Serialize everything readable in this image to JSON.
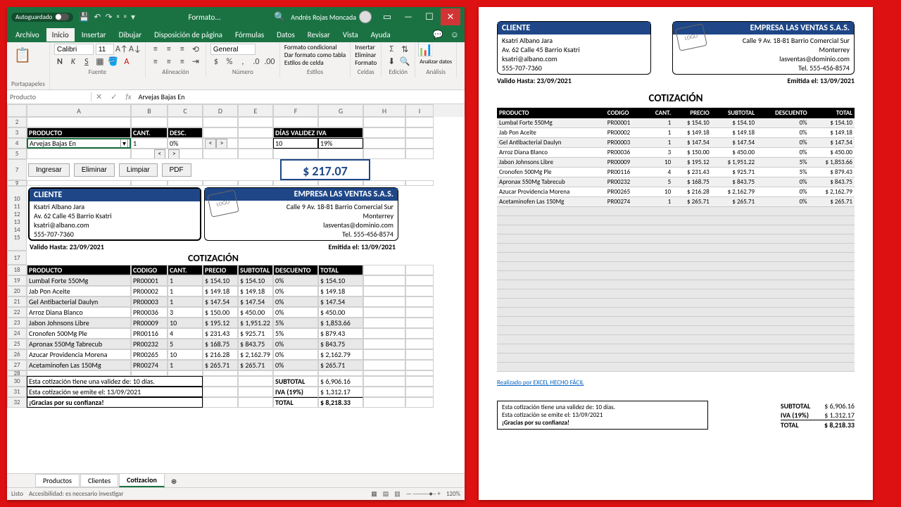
{
  "titlebar": {
    "autosave": "Autoguardado",
    "filename": "Formato...",
    "user": "Andrés Rojas Moncada"
  },
  "menutabs": [
    "Archivo",
    "Inicio",
    "Insertar",
    "Dibujar",
    "Disposición de página",
    "Fórmulas",
    "Datos",
    "Revisar",
    "Vista",
    "Ayuda"
  ],
  "font": {
    "name": "Calibri",
    "size": "11"
  },
  "ribbon": {
    "portapapeles": "Portapapeles",
    "fuente": "Fuente",
    "alineacion": "Alineación",
    "numero": "Número",
    "general": "General",
    "estilos": "Estilos",
    "fcond": "Formato condicional",
    "ftabla": "Dar formato como tabla",
    "fcelda": "Estilos de celda",
    "celdas": "Celdas",
    "insertar": "Insertar",
    "eliminar": "Eliminar",
    "formato": "Formato",
    "edicion": "Edición",
    "analisis": "Análisis",
    "analizar": "Analizar datos"
  },
  "namebox": {
    "name": "Producto",
    "formula": "Arvejas Bajas En"
  },
  "cols": [
    "A",
    "B",
    "C",
    "D",
    "E",
    "F",
    "G",
    "H",
    "I"
  ],
  "hdr": {
    "producto": "PRODUCTO",
    "cant": "CANT.",
    "desc": "DESC.",
    "validez": "DÍAS VALIDEZ",
    "iva": "IVA",
    "codigo": "CODIGO",
    "precio": "PRECIO",
    "subtotal": "SUBTOTAL",
    "descuento": "DESCUENTO",
    "total": "TOTAL"
  },
  "input": {
    "producto": "Arvejas Bajas En",
    "cant": "1",
    "desc": "0%",
    "dias": "10",
    "iva": "19%"
  },
  "buttons": {
    "ingresar": "Ingresar",
    "eliminar": "Eliminar",
    "limpiar": "Limpiar",
    "pdf": "PDF"
  },
  "bigtotal": "$ 217.07",
  "cliente": {
    "title": "CLIENTE",
    "name": "Ksatri Albano Jara",
    "addr": "Av. 62 Calle 45 Barrio Ksatri",
    "email": "ksatri@albano.com",
    "tel": "555-707-7360",
    "valido": "Valido Hasta: 23/09/2021"
  },
  "empresa": {
    "title": "EMPRESA LAS VENTAS S.A.S.",
    "addr": "Calle 9 Av. 18-81 Barrio Comercial Sur",
    "city": "Monterrey",
    "email": "lasventas@dominio.com",
    "tel": "Tel. 555-456-8574",
    "emitida": "Emitida el: 13/09/2021",
    "logo": "LOGO"
  },
  "cotizacion": "COTIZACIÓN",
  "items": [
    {
      "p": "Lumbal Forte 550Mg",
      "c": "PR00001",
      "q": "1",
      "pr": "$ 154.10",
      "st": "$ 154.10",
      "d": "0%",
      "t": "$ 154.10"
    },
    {
      "p": "Jab Pon Aceite",
      "c": "PR00002",
      "q": "1",
      "pr": "$ 149.18",
      "st": "$ 149.18",
      "d": "0%",
      "t": "$ 149.18"
    },
    {
      "p": "Gel Antibacterial Daulyn",
      "c": "PR00003",
      "q": "1",
      "pr": "$ 147.54",
      "st": "$ 147.54",
      "d": "0%",
      "t": "$ 147.54"
    },
    {
      "p": "Arroz Diana Blanco",
      "c": "PR00036",
      "q": "3",
      "pr": "$ 150.00",
      "st": "$ 450.00",
      "d": "0%",
      "t": "$ 450.00"
    },
    {
      "p": "Jabon Johnsons Libre",
      "c": "PR00009",
      "q": "10",
      "pr": "$ 195.12",
      "st": "$ 1,951.22",
      "d": "5%",
      "t": "$ 1,853.66"
    },
    {
      "p": "Cronofen 500Mg Ple",
      "c": "PR00116",
      "q": "4",
      "pr": "$ 231.43",
      "st": "$ 925.71",
      "d": "5%",
      "t": "$ 879.43"
    },
    {
      "p": "Apronax 550Mg Tabrecub",
      "c": "PR00232",
      "q": "5",
      "pr": "$ 168.75",
      "st": "$ 843.75",
      "d": "0%",
      "t": "$ 843.75"
    },
    {
      "p": "Azucar Providencia Morena",
      "c": "PR00265",
      "q": "10",
      "pr": "$ 216.28",
      "st": "$ 2,162.79",
      "d": "0%",
      "t": "$ 2,162.79"
    },
    {
      "p": "Acetaminofen Las 150Mg",
      "c": "PR00274",
      "q": "1",
      "pr": "$ 265.71",
      "st": "$ 265.71",
      "d": "0%",
      "t": "$ 265.71"
    }
  ],
  "notes": {
    "l1": "Esta cotización tiene una validez de: 10 días.",
    "l2": "Esta cotización se emite el: 13/09/2021",
    "l3": "¡Gracias por su confianza!"
  },
  "totals": {
    "sub_l": "SUBTOTAL",
    "sub_v": "$ 6,906.16",
    "iva_l": "IVA (19%)",
    "iva_v": "$ 1,312.17",
    "tot_l": "TOTAL",
    "tot_v": "$ 8,218.33"
  },
  "sheets": [
    "Productos",
    "Clientes",
    "Cotizacion"
  ],
  "status": {
    "listo": "Listo",
    "acc": "Accesibilidad: es necesario investigar",
    "zoom": "120%"
  },
  "linktxt": "Realizado por EXCEL HECHO FÁCIL"
}
